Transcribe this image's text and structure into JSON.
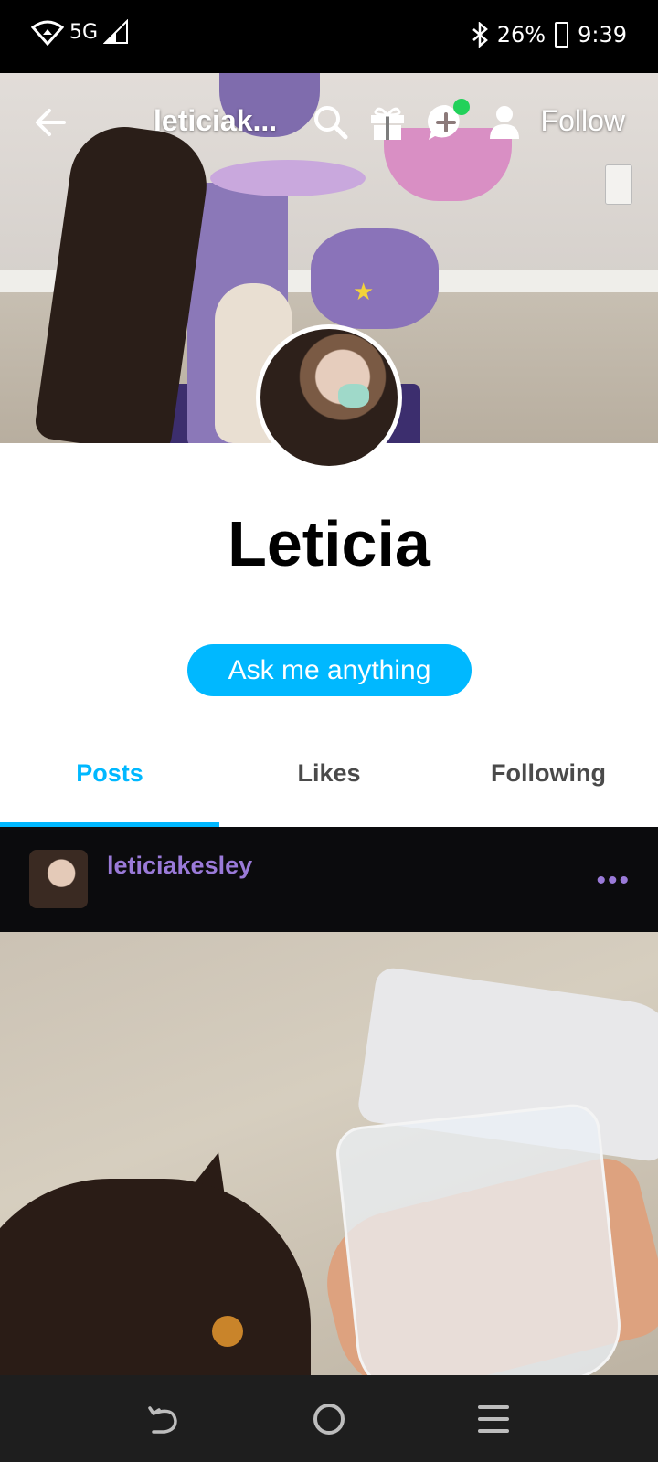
{
  "status_bar": {
    "network": "5G",
    "battery_percent": "26%",
    "time": "9:39",
    "icons": [
      "wifi-icon",
      "cellular-signal-icon",
      "bluetooth-icon",
      "battery-icon"
    ]
  },
  "top_nav": {
    "blog_title": "leticiak...",
    "follow_label": "Follow",
    "icons": [
      "back-arrow-icon",
      "search-icon",
      "gift-icon",
      "new-chat-icon",
      "person-icon"
    ],
    "notification_color": "#22d15a"
  },
  "profile": {
    "name": "Leticia",
    "ask_button_label": "Ask me anything",
    "accent_color": "#00b8ff"
  },
  "tabs": [
    {
      "label": "Posts",
      "active": true
    },
    {
      "label": "Likes",
      "active": false
    },
    {
      "label": "Following",
      "active": false
    }
  ],
  "post": {
    "username": "leticiakesley",
    "more_label": "•••",
    "username_color": "#9a7ad8"
  },
  "nav_bar": {
    "icons": [
      "back-gesture-icon",
      "home-circle-icon",
      "menu-lines-icon"
    ]
  }
}
